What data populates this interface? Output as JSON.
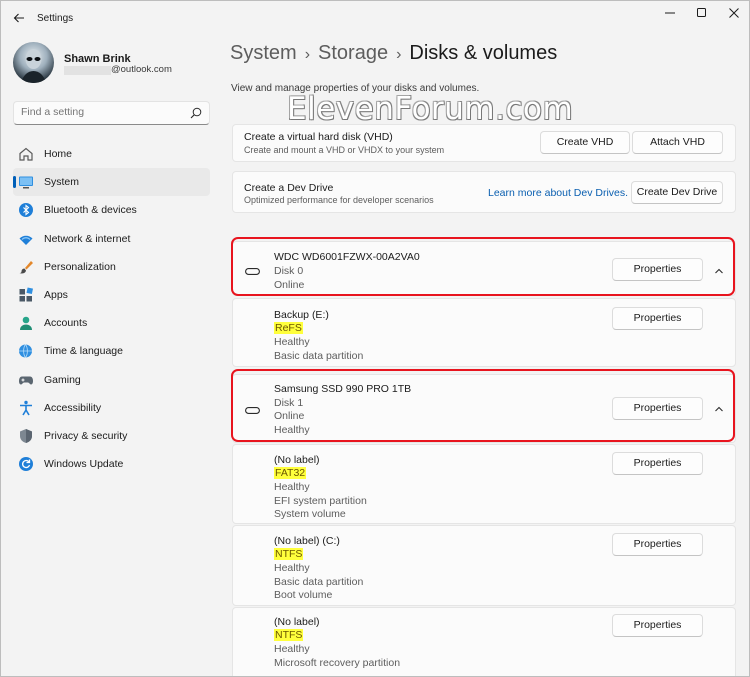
{
  "titlebar": {
    "app_title": "Settings"
  },
  "profile": {
    "name": "Shawn Brink",
    "email_suffix": "@outlook.com"
  },
  "search": {
    "placeholder": "Find a setting"
  },
  "nav": [
    {
      "label": "Home",
      "icon": "home-icon"
    },
    {
      "label": "System",
      "icon": "system-icon",
      "active": true
    },
    {
      "label": "Bluetooth & devices",
      "icon": "bluetooth-icon"
    },
    {
      "label": "Network & internet",
      "icon": "network-icon"
    },
    {
      "label": "Personalization",
      "icon": "brush-icon"
    },
    {
      "label": "Apps",
      "icon": "apps-icon"
    },
    {
      "label": "Accounts",
      "icon": "accounts-icon"
    },
    {
      "label": "Time & language",
      "icon": "globe-clock-icon"
    },
    {
      "label": "Gaming",
      "icon": "gamepad-icon"
    },
    {
      "label": "Accessibility",
      "icon": "accessibility-icon"
    },
    {
      "label": "Privacy & security",
      "icon": "shield-icon"
    },
    {
      "label": "Windows Update",
      "icon": "update-icon"
    }
  ],
  "breadcrumb": {
    "part1": "System",
    "part2": "Storage",
    "current": "Disks & volumes",
    "separator": "›"
  },
  "description": "View and manage properties of your disks and volumes.",
  "watermark": "ElevenForum.com",
  "vhd": {
    "title": "Create a virtual hard disk (VHD)",
    "subtitle": "Create and mount a VHD or VHDX to your system",
    "create_label": "Create VHD",
    "attach_label": "Attach VHD"
  },
  "devdrive": {
    "title": "Create a Dev Drive",
    "subtitle": "Optimized performance for developer scenarios",
    "link_label": "Learn more about Dev Drives.",
    "button_label": "Create Dev Drive"
  },
  "properties_label": "Properties",
  "disk0": {
    "name": "WDC WD6001FZWX-00A2VA0",
    "number": "Disk 0",
    "status": "Online",
    "volumes": [
      {
        "label": "Backup (E:)",
        "fs": "ReFS",
        "health": "Healthy",
        "type": "Basic data partition"
      }
    ]
  },
  "disk1": {
    "name": "Samsung SSD 990 PRO 1TB",
    "number": "Disk 1",
    "status": "Online",
    "health": "Healthy",
    "volumes": [
      {
        "label": "(No label)",
        "fs": "FAT32",
        "health": "Healthy",
        "type": "EFI system partition",
        "role": "System volume"
      },
      {
        "label": "(No label) (C:)",
        "fs": "NTFS",
        "health": "Healthy",
        "type": "Basic data partition",
        "role": "Boot volume"
      },
      {
        "label": "(No label)",
        "fs": "NTFS",
        "health": "Healthy",
        "type": "Microsoft recovery partition"
      }
    ]
  },
  "colors": {
    "accent": "#005fb8",
    "highlight": "#ffff3c",
    "annotation_box": "#e8141e",
    "link": "#0a5fb0"
  }
}
